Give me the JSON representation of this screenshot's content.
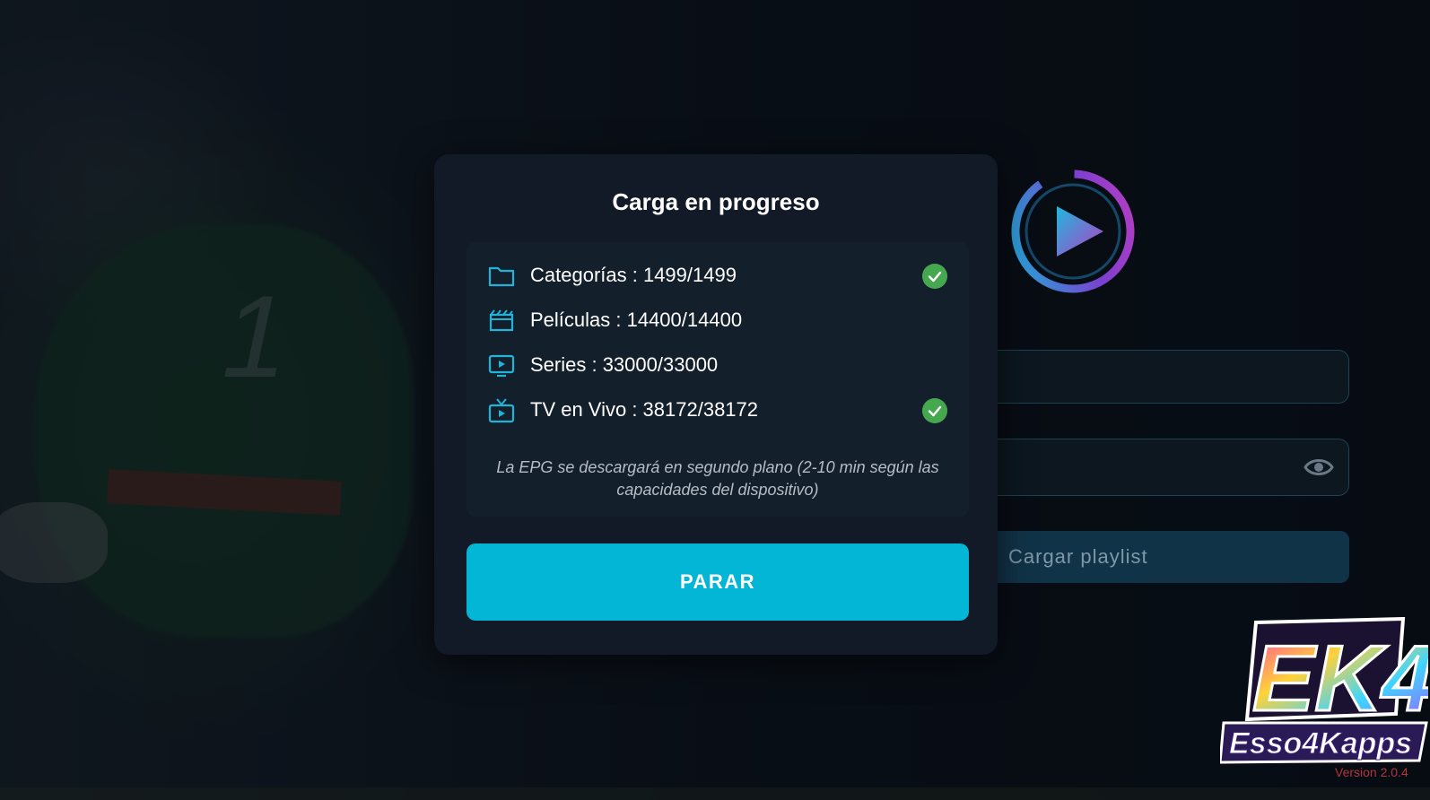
{
  "dialog": {
    "title": "Carga en progreso",
    "items": [
      {
        "label": "Categorías : 1499/1499",
        "icon": "folder-icon",
        "done": true
      },
      {
        "label": "Películas : 14400/14400",
        "icon": "clapperboard-icon",
        "done": false
      },
      {
        "label": "Series : 33000/33000",
        "icon": "monitor-play-icon",
        "done": false
      },
      {
        "label": "TV en Vivo : 38172/38172",
        "icon": "tv-icon",
        "done": true
      }
    ],
    "note": "La EPG se descargará en segundo plano (2-10 min según las capacidades del dispositivo)",
    "stop_label": "PARAR"
  },
  "login": {
    "load_label": "Cargar playlist"
  },
  "brand": {
    "logo_text_top": "EK4",
    "logo_text_bottom": "Esso4Kapps",
    "version": "Version 2.0.4"
  },
  "colors": {
    "accent": "#04b6d5",
    "success": "#46a84e",
    "dialog_bg": "#111a26",
    "icon": "#1fb4d8"
  }
}
